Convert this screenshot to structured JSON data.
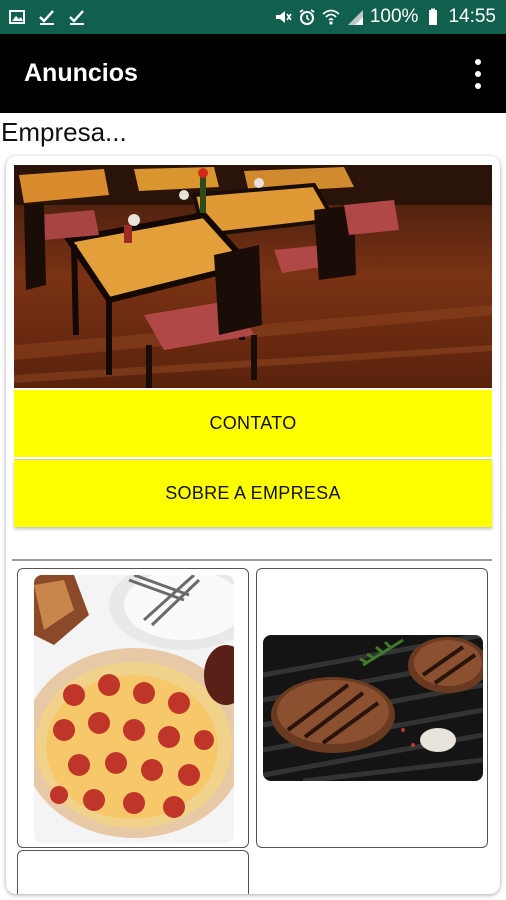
{
  "status_bar": {
    "icons_left": [
      "image-icon",
      "check-icon",
      "check-icon"
    ],
    "icons_right": [
      "mute-icon",
      "alarm-icon",
      "wifi-icon",
      "signal-icon",
      "battery-icon"
    ],
    "battery": "100%",
    "time": "14:55"
  },
  "app_bar": {
    "title": "Anuncios"
  },
  "company_label": "Empresa...",
  "buttons": {
    "contact": "CONTATO",
    "about": "SOBRE A EMPRESA"
  },
  "colors": {
    "status_bar": "#115f4d",
    "app_bar": "#000000",
    "button": "#ffff00"
  },
  "gallery": [
    "pizza",
    "grilled-burger"
  ]
}
